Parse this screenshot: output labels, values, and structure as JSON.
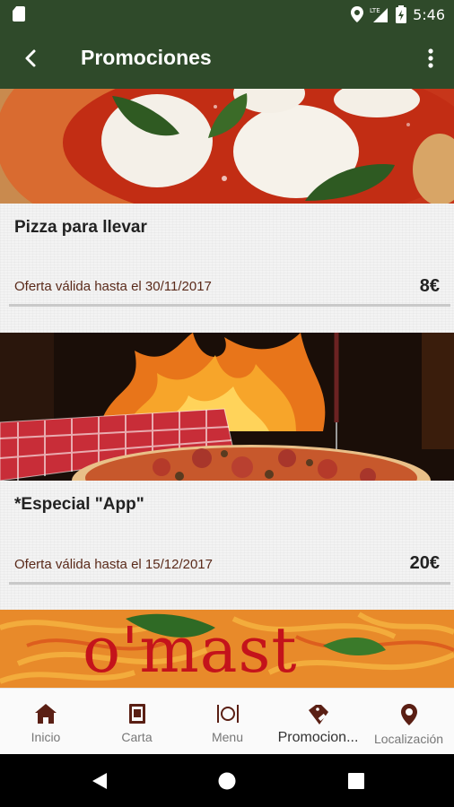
{
  "status_bar": {
    "time": "5:46",
    "network_label": "LTE"
  },
  "app_bar": {
    "title": "Promociones"
  },
  "promotions": [
    {
      "name": "Pizza para llevar",
      "valid_text": "Oferta válida hasta el 30/11/2017",
      "price": "8€",
      "image": "pizza-margherita-image"
    },
    {
      "name": "*Especial \"App\"",
      "valid_text": "Oferta válida hasta el 15/12/2017",
      "price": "20€",
      "image": "pizza-oven-fire-image"
    },
    {
      "image": "pasta-omast-image",
      "logo_text": "o'mast"
    }
  ],
  "bottom_nav": [
    {
      "label": "Inicio",
      "icon": "home-icon",
      "active": false
    },
    {
      "label": "Carta",
      "icon": "menu-book-icon",
      "active": false
    },
    {
      "label": "Menu",
      "icon": "cutlery-icon",
      "active": false
    },
    {
      "label": "Promocion...",
      "icon": "tags-icon",
      "active": true
    },
    {
      "label": "Localización",
      "icon": "location-pin-icon",
      "active": false
    }
  ],
  "colors": {
    "app_bar": "#2f4a2a",
    "nav_icon": "#5a1f14",
    "price_text": "#222222",
    "valid_text": "#5a2a1a"
  }
}
